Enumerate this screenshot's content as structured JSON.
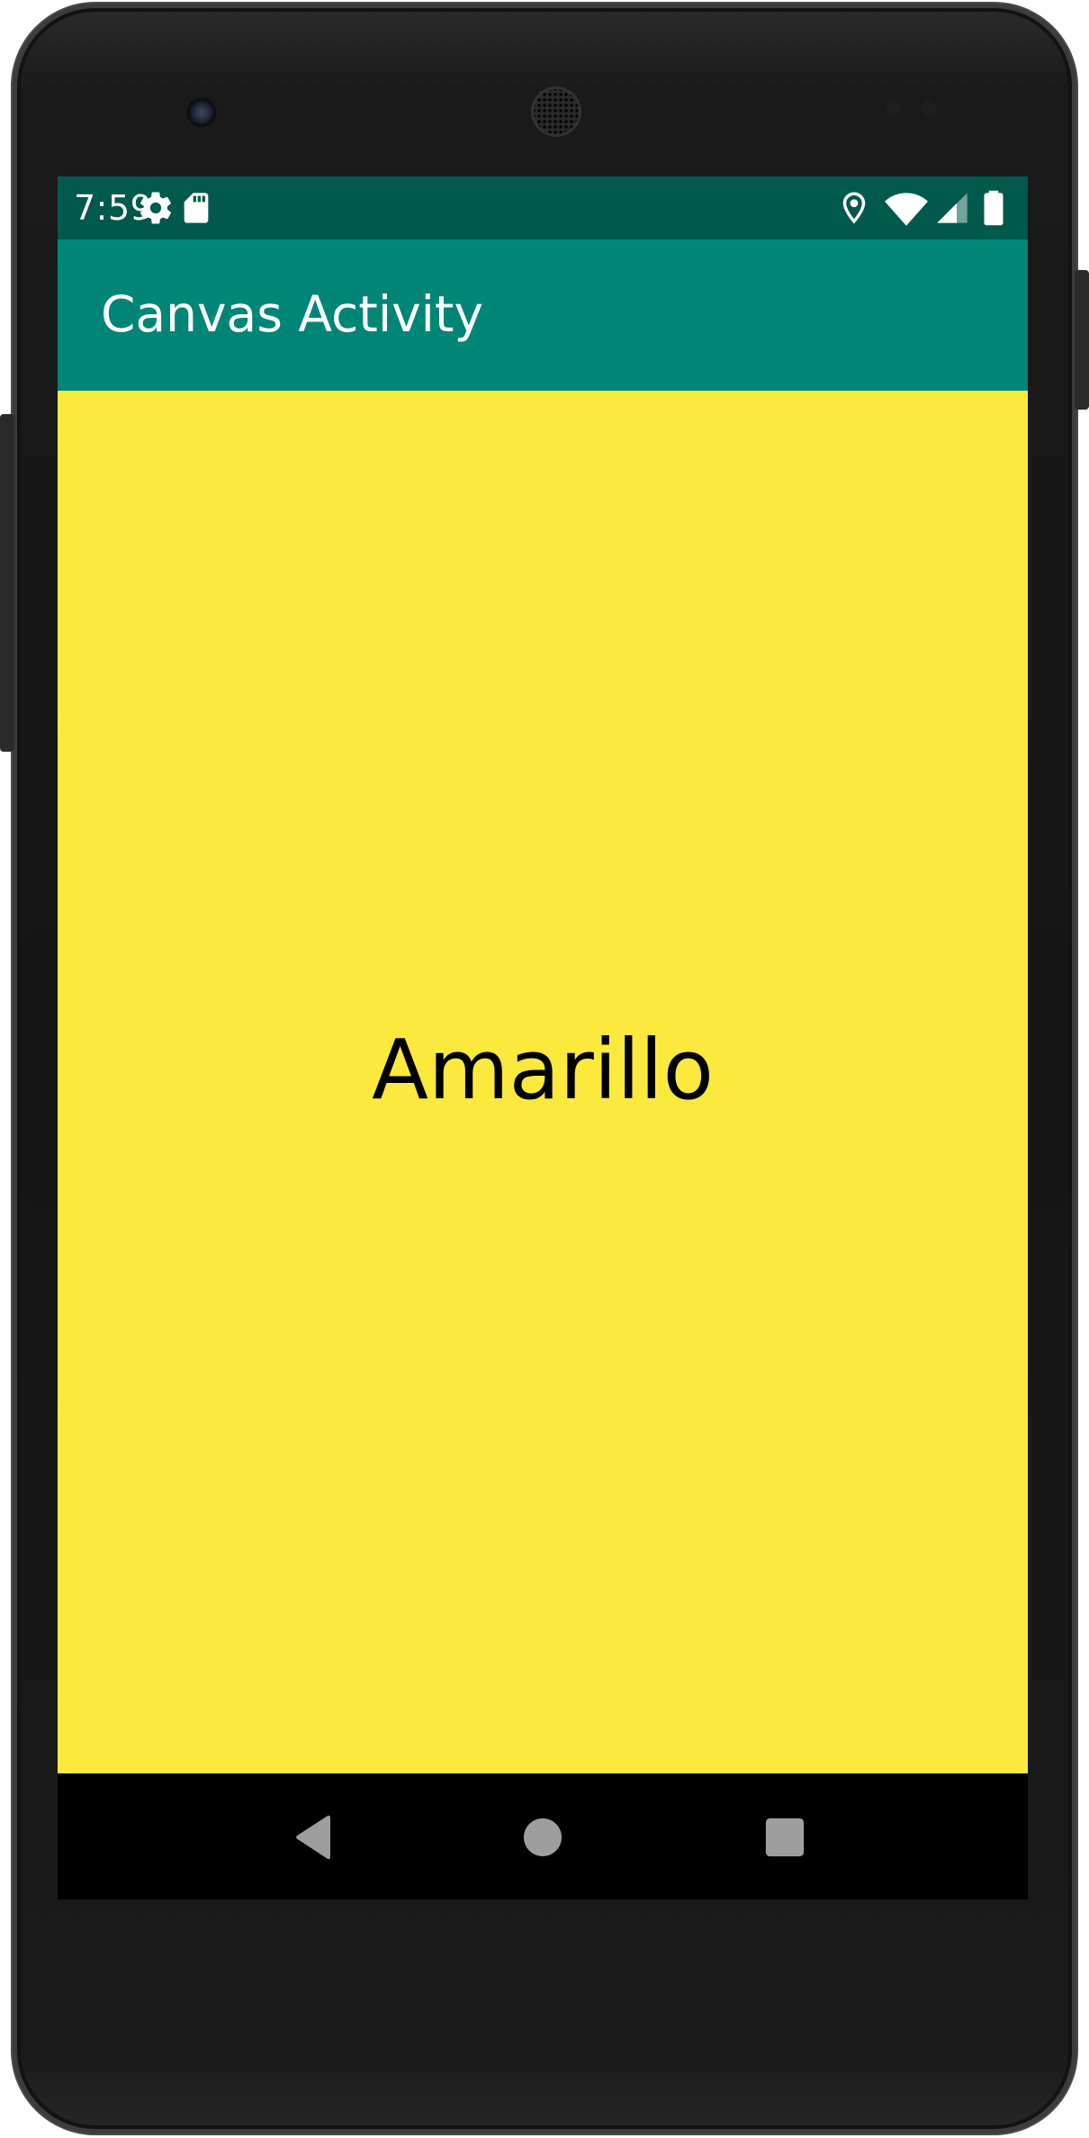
{
  "status_bar": {
    "time": "7:59",
    "icons": [
      "settings-icon",
      "sd-card-icon",
      "location-icon",
      "wifi-icon",
      "signal-icon",
      "battery-icon"
    ]
  },
  "app_bar": {
    "title": "Canvas Activity"
  },
  "content": {
    "color_name": "Amarillo",
    "background_color": "#fce93e"
  },
  "nav_bar": {
    "buttons": [
      "back-icon",
      "home-icon",
      "recents-icon"
    ]
  },
  "colors": {
    "status_bar": "#00594c",
    "app_bar": "#008577",
    "nav_bar": "#000000",
    "nav_icons": "#9e9e9e"
  }
}
